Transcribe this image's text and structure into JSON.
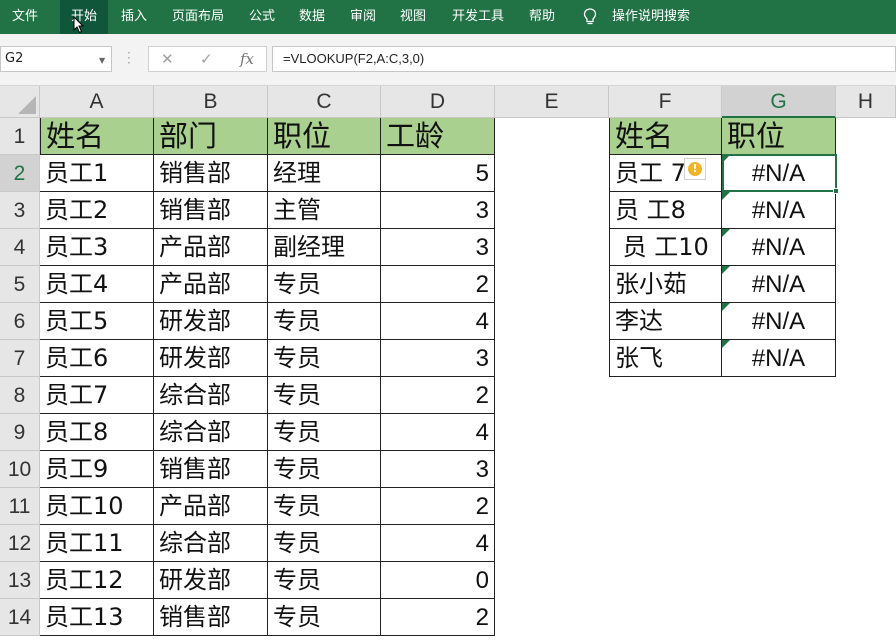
{
  "ribbon": {
    "tabs": [
      "文件",
      "开始",
      "插入",
      "页面布局",
      "公式",
      "数据",
      "审阅",
      "视图",
      "开发工具",
      "帮助"
    ],
    "active_tab": "开始",
    "tell_me": "操作说明搜索"
  },
  "formula_bar": {
    "name_box": "G2",
    "cancel_glyph": "✕",
    "enter_glyph": "✓",
    "fx_glyph": "fx",
    "formula": "=VLOOKUP(F2,A:C,3,0)"
  },
  "sheet": {
    "columns": [
      "A",
      "B",
      "C",
      "D",
      "E",
      "F",
      "G",
      "H"
    ],
    "selected_column": "G",
    "rows": [
      "1",
      "2",
      "3",
      "4",
      "5",
      "6",
      "7",
      "8",
      "9",
      "10",
      "11",
      "12",
      "13",
      "14"
    ],
    "selected_row": "2",
    "main_table": {
      "headers": [
        "姓名",
        "部门",
        "职位",
        "工龄"
      ],
      "rows": [
        [
          "员工1",
          "销售部",
          "经理",
          "5"
        ],
        [
          "员工2",
          "销售部",
          "主管",
          "3"
        ],
        [
          "员工3",
          "产品部",
          "副经理",
          "3"
        ],
        [
          "员工4",
          "产品部",
          "专员",
          "2"
        ],
        [
          "员工5",
          "研发部",
          "专员",
          "4"
        ],
        [
          "员工6",
          "研发部",
          "专员",
          "3"
        ],
        [
          "员工7",
          "综合部",
          "专员",
          "2"
        ],
        [
          "员工8",
          "综合部",
          "专员",
          "4"
        ],
        [
          "员工9",
          "销售部",
          "专员",
          "3"
        ],
        [
          "员工10",
          "产品部",
          "专员",
          "2"
        ],
        [
          "员工11",
          "综合部",
          "专员",
          "4"
        ],
        [
          "员工12",
          "研发部",
          "专员",
          "0"
        ],
        [
          "员工13",
          "销售部",
          "专员",
          "2"
        ]
      ]
    },
    "lookup_table": {
      "headers": [
        "姓名",
        "职位"
      ],
      "rows": [
        [
          "员工 7",
          "#N/A"
        ],
        [
          "员 工8",
          "#N/A"
        ],
        [
          " 员 工10",
          "#N/A"
        ],
        [
          "张小茹",
          "#N/A"
        ],
        [
          "李达",
          "#N/A"
        ],
        [
          "张飞",
          "#N/A"
        ]
      ]
    },
    "header_fill": "#A9D08E",
    "accent": "#217346",
    "warning_icon": "error-warning-icon"
  }
}
